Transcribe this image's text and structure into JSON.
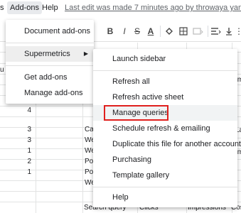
{
  "menubar": {
    "items": [
      {
        "label": "s"
      },
      {
        "label": "Add-ons"
      },
      {
        "label": "Help"
      }
    ],
    "last_edit": "Last edit was made 7 minutes ago by throwaya yank"
  },
  "toolbar": {
    "bold": "B",
    "italic": "I",
    "strike": "S",
    "text_color": "A",
    "more": "⋮"
  },
  "addons_menu": {
    "items": [
      {
        "label": "Document add-ons"
      },
      {
        "label": "Supermetrics",
        "has_submenu": true
      },
      {
        "label": "Get add-ons"
      },
      {
        "label": "Manage add-ons"
      }
    ]
  },
  "supermetrics_menu": {
    "items": [
      {
        "label": "Launch sidebar"
      },
      {
        "label": "Refresh all"
      },
      {
        "label": "Refresh active sheet"
      },
      {
        "label": "Manage queries"
      },
      {
        "label": "Schedule refresh & emailing"
      },
      {
        "label": "Duplicate this file for another account"
      },
      {
        "label": "Purchasing"
      },
      {
        "label": "Template gallery"
      },
      {
        "label": "Help"
      }
    ],
    "highlighted": "Manage queries"
  },
  "grid": {
    "row_numbers": [
      "4",
      "4",
      "3",
      "3",
      "1",
      "2",
      "1"
    ],
    "col_fragments": [
      {
        "text": "Ca"
      },
      {
        "text": "We"
      },
      {
        "text": "We"
      },
      {
        "text": "Pos"
      },
      {
        "text": "Pos"
      },
      {
        "text": "We"
      }
    ],
    "right_fragments": [
      "Im",
      "La",
      "Im"
    ],
    "left_fragment": "u",
    "footer": {
      "search_query": "Search query",
      "clicks": "Clicks",
      "impressions": "Impressions",
      "cost": "Cos"
    }
  },
  "colors": {
    "highlight": "#e0201e",
    "menubar_active": "#e8eaed"
  }
}
